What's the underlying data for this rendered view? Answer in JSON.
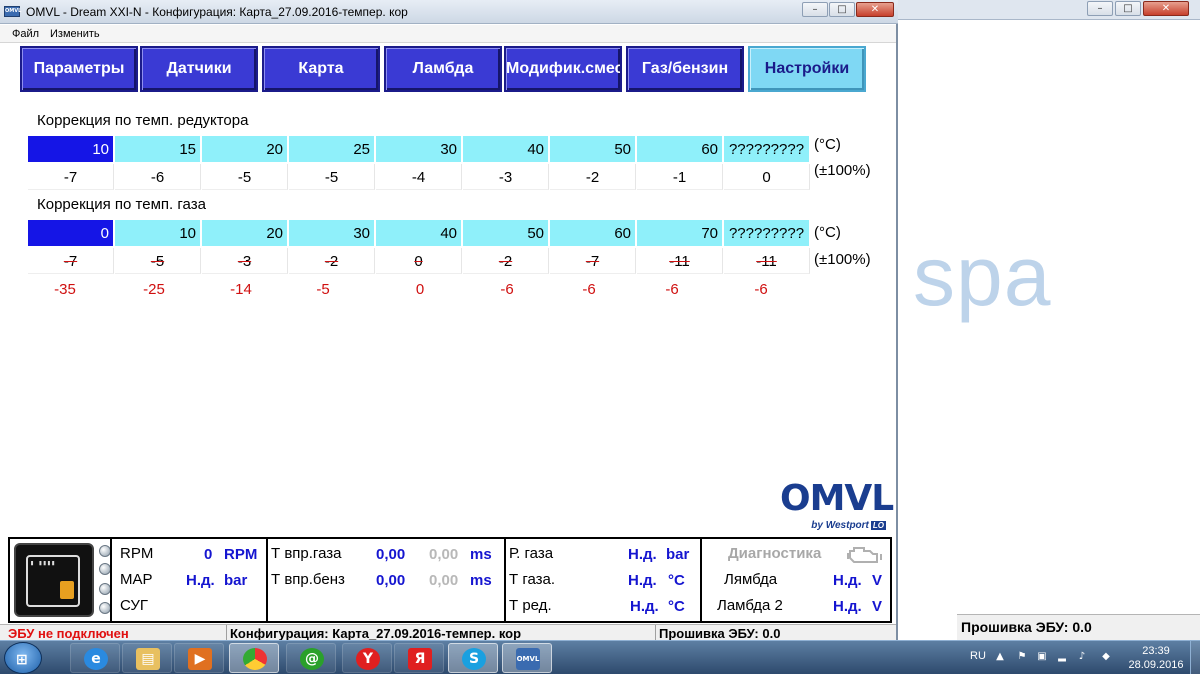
{
  "app": {
    "title": "OMVL - Dream XXI-N - Конфигурация: Карта_27.09.2016-темпер. кор",
    "icon": "omvl-app-icon"
  },
  "window_buttons": {
    "minimize": "–",
    "maximize": "□",
    "close": "✕"
  },
  "menu": [
    "Файл",
    "Изменить"
  ],
  "tabs": [
    {
      "label": "Параметры",
      "active": false
    },
    {
      "label": "Датчики",
      "active": false
    },
    {
      "label": "Карта",
      "active": false
    },
    {
      "label": "Ламбда",
      "active": false
    },
    {
      "label": "Модифик.смеси",
      "active": false
    },
    {
      "label": "Газ/бензин",
      "active": false
    },
    {
      "label": "Настройки",
      "active": true
    }
  ],
  "reducer_correction": {
    "title": "Коррекция по темп. редуктора",
    "temps": [
      "10",
      "15",
      "20",
      "25",
      "30",
      "40",
      "50",
      "60",
      "?????????"
    ],
    "values": [
      "-7",
      "-6",
      "-5",
      "-5",
      "-4",
      "-3",
      "-2",
      "-1",
      "0"
    ],
    "unit_temp": "(°C)",
    "unit_pct": "(±100%)"
  },
  "gas_correction": {
    "title": "Коррекция по темп. газа",
    "temps": [
      "0",
      "10",
      "20",
      "30",
      "40",
      "50",
      "60",
      "70",
      "?????????"
    ],
    "old_values": [
      "-7",
      "-5",
      "-3",
      "-2",
      "0",
      "-2",
      "-7",
      "-11",
      "-11"
    ],
    "new_values": [
      "-35",
      "-25",
      "-14",
      "-5",
      "0",
      "-6",
      "-6",
      "-6",
      "-6"
    ],
    "unit_temp": "(°C)",
    "unit_pct": "(±100%)"
  },
  "logo": {
    "brand": "OMVL",
    "by": "by Westport",
    "tag": "LO"
  },
  "status": {
    "rpm": {
      "label": "RPM",
      "value": "0",
      "unit": "RPM"
    },
    "map": {
      "label": "MAP",
      "value": "Н.д.",
      "unit": "bar"
    },
    "sug": {
      "label": "СУГ"
    },
    "t_gas_inj": {
      "label": "Т впр.газа",
      "value": "0,00",
      "ref": "0,00",
      "unit": "ms"
    },
    "t_pet_inj": {
      "label": "Т впр.бенз",
      "value": "0,00",
      "ref": "0,00",
      "unit": "ms"
    },
    "p_gas": {
      "label": "Р. газа",
      "value": "Н.д.",
      "unit": "bar"
    },
    "t_gas": {
      "label": "Т газа.",
      "value": "Н.д.",
      "unit": "°C"
    },
    "t_red": {
      "label": "Т ред.",
      "value": "Н.д.",
      "unit": "°C"
    },
    "diag": {
      "label": "Диагностика"
    },
    "lambda": {
      "label": "Лямбда",
      "value": "Н.д.",
      "unit": "V"
    },
    "lambda2": {
      "label": "Ламбда 2",
      "value": "Н.д.",
      "unit": "V"
    }
  },
  "statusbar": {
    "ecu": "ЭБУ не подключен",
    "config": "Конфигурация: Карта_27.09.2016-темпер. кор",
    "firmware": "Прошивка ЭБУ: 0.0"
  },
  "background_window": {
    "watermark": "spa",
    "firmware": "Прошивка ЭБУ: 0.0"
  },
  "taskbar": {
    "apps": [
      "internet-explorer-icon",
      "file-explorer-icon",
      "media-player-icon",
      "chrome-icon",
      "mail-ru-agent-icon",
      "yandex-browser-icon",
      "yandex-icon",
      "skype-icon",
      "omvl-app-icon"
    ],
    "lang": "RU",
    "time": "23:39",
    "date": "28.09.2016"
  },
  "colors": {
    "tab_bg": "#3a3ad4",
    "tab_active_bg": "#7fd8f4",
    "cell_cyan": "#8ff0fa",
    "cell_selected": "#1515e6",
    "value_blue": "#1515d0",
    "alert_red": "#d01010"
  }
}
